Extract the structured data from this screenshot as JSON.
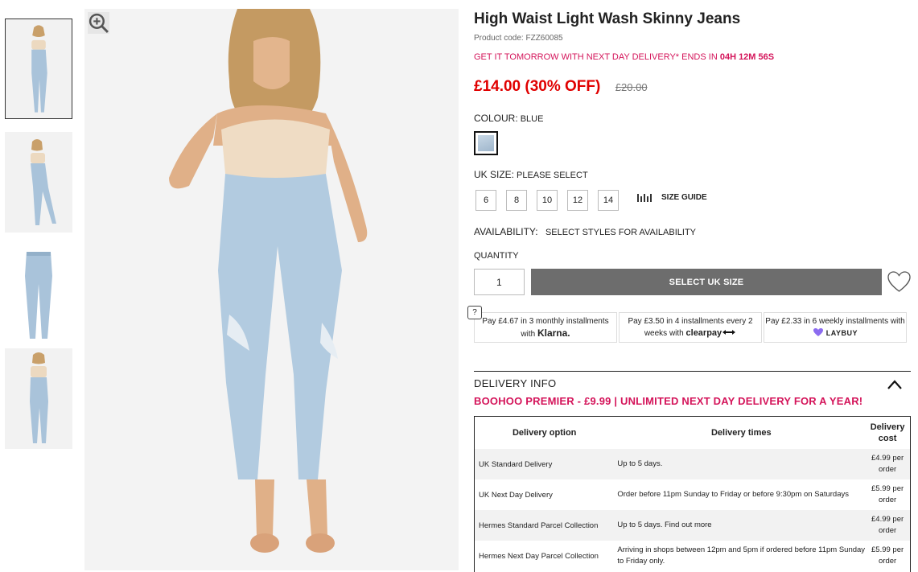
{
  "product": {
    "title": "High Waist Light Wash Skinny Jeans",
    "code_label": "Product code: FZZ60085",
    "promo_text": "GET IT TOMORROW WITH NEXT DAY DELIVERY* ENDS IN",
    "promo_countdown": "04H 12M 56S",
    "price_now": "£14.00 (30% OFF)",
    "price_was": "£20.00"
  },
  "colour": {
    "label": "COLOUR:",
    "value": "BLUE"
  },
  "size": {
    "label": "UK SIZE:",
    "value": "PLEASE SELECT",
    "options": [
      "6",
      "8",
      "10",
      "12",
      "14"
    ],
    "guide_label": "SIZE GUIDE"
  },
  "availability": {
    "label": "AVAILABILITY:",
    "value": "SELECT STYLES FOR AVAILABILITY"
  },
  "quantity": {
    "label": "QUANTITY",
    "value": "1"
  },
  "cta": {
    "label": "SELECT UK SIZE"
  },
  "help": {
    "label": "?"
  },
  "payments": [
    {
      "pre": "Pay ",
      "amount": "£4.67",
      "mid": " in 3 monthly installments with ",
      "brand": "Klarna."
    },
    {
      "pre": "Pay ",
      "amount": "£3.50",
      "mid": " in 4 installments every 2 weeks with ",
      "brand": "clearpay"
    },
    {
      "pre": "Pay ",
      "amount": "£2.33",
      "mid": " in 6 weekly installments with ",
      "brand": "LAYBUY"
    }
  ],
  "delivery": {
    "title": "DELIVERY INFO",
    "premier": "BOOHOO PREMIER - £9.99 | UNLIMITED NEXT DAY DELIVERY FOR A YEAR!",
    "headers": [
      "Delivery option",
      "Delivery times",
      "Delivery cost"
    ],
    "rows": [
      {
        "option": "UK Standard Delivery",
        "time": "Up to 5 days.",
        "cost": "£4.99 per order"
      },
      {
        "option": "UK Next Day Delivery",
        "time": "Order before 11pm Sunday to Friday or before 9:30pm on Saturdays",
        "cost": "£5.99 per order"
      },
      {
        "option": "Hermes Standard Parcel Collection",
        "time": "Up to 5 days. Find out more",
        "cost": "£4.99 per order"
      },
      {
        "option": "Hermes Next Day Parcel Collection",
        "time": "Arriving in shops between 12pm and 5pm if ordered before 11pm Sunday to Friday only.",
        "cost": "£5.99 per order"
      }
    ]
  },
  "icons": {
    "zoom": "zoom-in-icon",
    "size_guide": "ruler-bars-icon",
    "wishlist": "heart-outline-icon",
    "collapse": "chevron-up-icon"
  },
  "colors": {
    "accent_pink": "#d4145a",
    "sale_red": "#e00000",
    "button_grey": "#6d6d6d"
  }
}
